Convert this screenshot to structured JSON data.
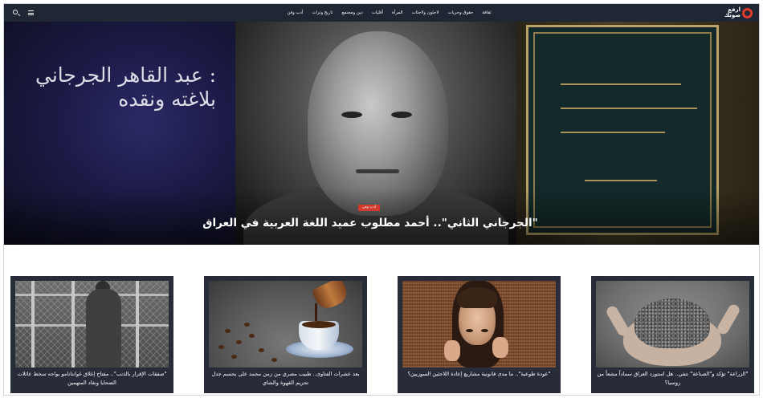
{
  "site": {
    "logo_line1": "ارفع",
    "logo_line2": "صوتك"
  },
  "nav": {
    "links": [
      "ثقافة",
      "حقوق وحريات",
      "لاجئون ولاجئات",
      "المرأة",
      "أقليات",
      "دين ومجتمع",
      "تاريخ وتراث",
      "أدب وفن"
    ]
  },
  "icons": {
    "search": "search-icon",
    "menu": "menu-icon"
  },
  "hero": {
    "image_text": ": عبد القاهر الجرجاني بلاغته ونقده",
    "category": "أدب وفن",
    "headline": "\"الجرجاني الثاني\".. أحمد مطلوب عميد اللغة العربية في العراق"
  },
  "cards": [
    {
      "title": "\"صفقات الإقرار بالذنب\".. مفتاح إغلاق غوانتانامو يواجه سخط عائلات الضحايا ونقاد المتهمين"
    },
    {
      "title": "بعد عشرات الفتاوى.. طبيب مصري من زمن محمد علي يحسم جدل تحريم القهوة والشاي"
    },
    {
      "title": "\"عودة طوعية\".. ما مدى قانونية مشاريع إعادة اللاجئين السوريين؟"
    },
    {
      "title": "\"الزراعة\" تؤكد و\"الصناعة\" تنفي.. هل استورد العراق سماداً مشعاً من روسيا؟"
    }
  ],
  "colors": {
    "nav_bg": "#1e2733",
    "accent_red": "#d23a2e",
    "card_bg": "#272c38"
  }
}
